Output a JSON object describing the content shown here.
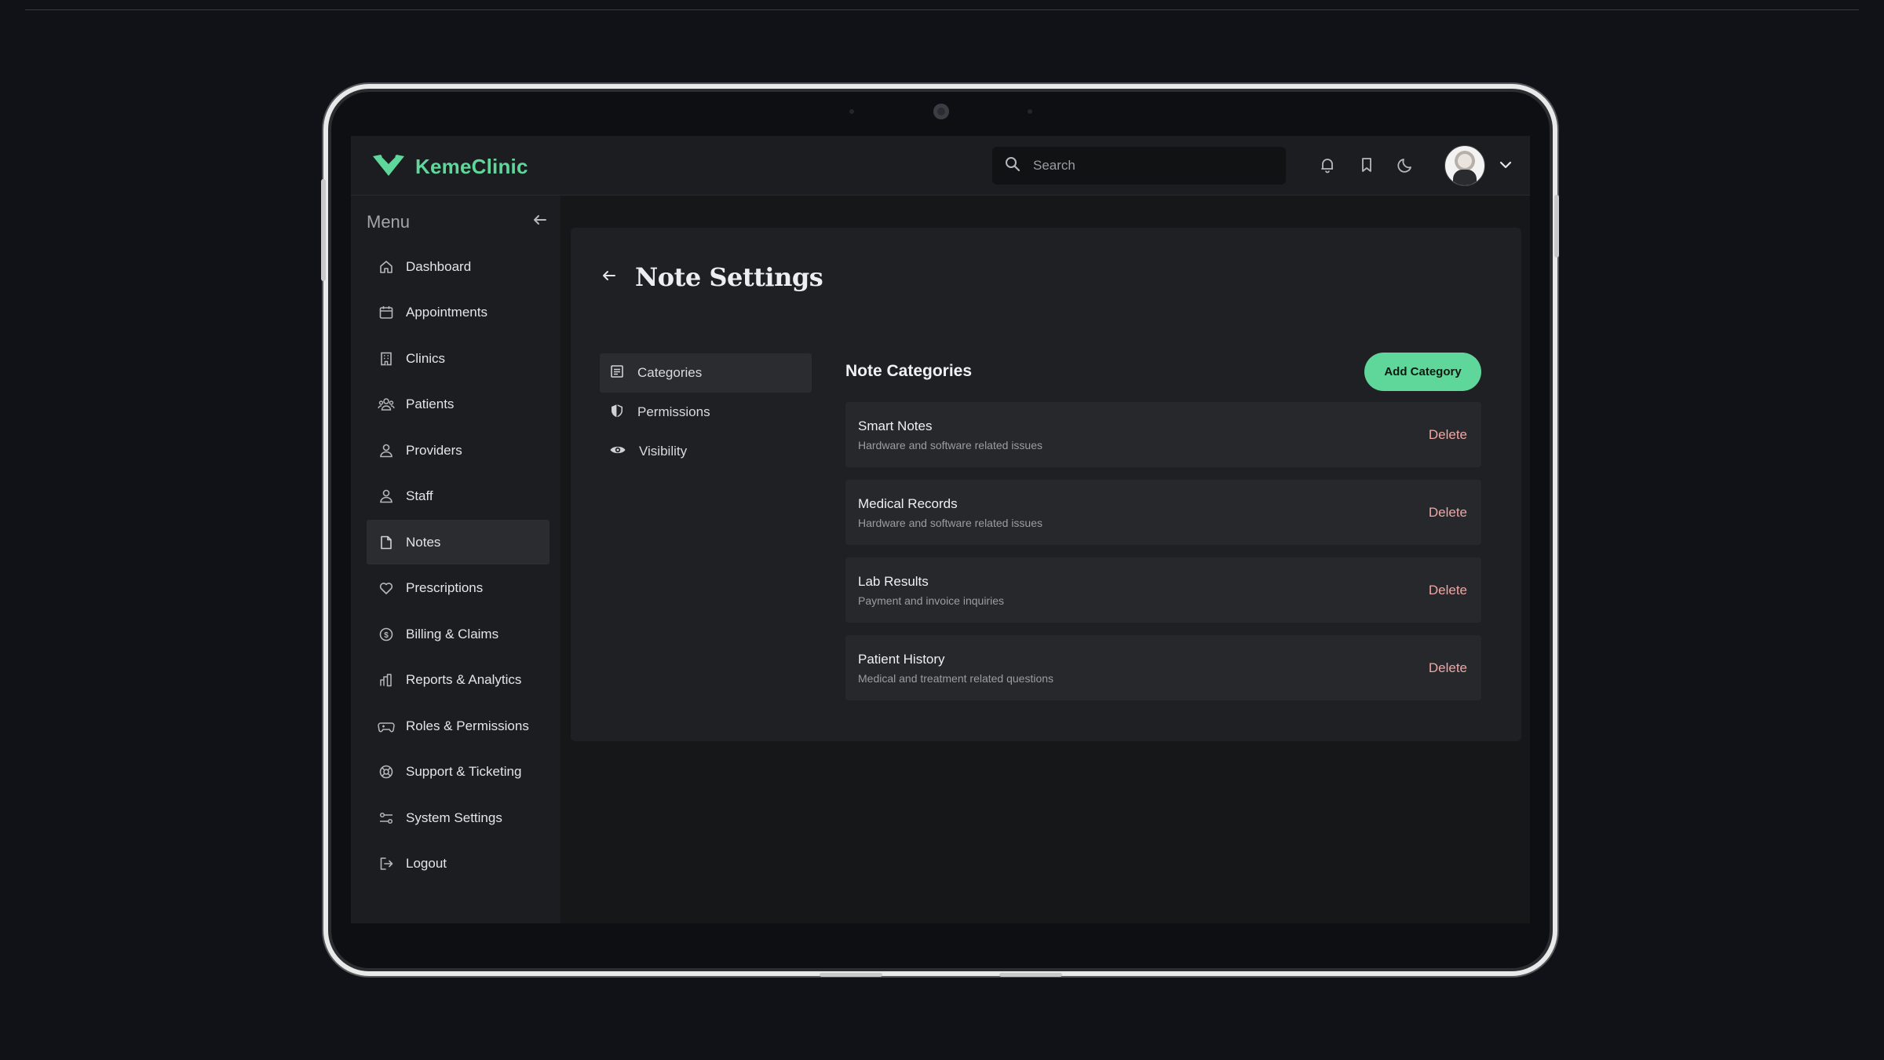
{
  "app": {
    "brand": "KemeClinic"
  },
  "header": {
    "search_placeholder": "Search"
  },
  "sidebar": {
    "title": "Menu",
    "items": [
      {
        "label": "Dashboard"
      },
      {
        "label": "Appointments"
      },
      {
        "label": "Clinics"
      },
      {
        "label": "Patients"
      },
      {
        "label": "Providers"
      },
      {
        "label": "Staff"
      },
      {
        "label": "Notes",
        "active": true
      },
      {
        "label": "Prescriptions"
      },
      {
        "label": "Billing & Claims"
      },
      {
        "label": "Reports & Analytics"
      },
      {
        "label": "Roles & Permissions"
      },
      {
        "label": "Support & Ticketing"
      },
      {
        "label": "System Settings"
      },
      {
        "label": "Logout"
      }
    ]
  },
  "page": {
    "title": "Note Settings",
    "subnav": [
      {
        "label": "Categories",
        "active": true
      },
      {
        "label": "Permissions"
      },
      {
        "label": "Visibility"
      }
    ],
    "categories_title": "Note Categories",
    "add_label": "Add Category",
    "delete_label": "Delete",
    "categories": [
      {
        "name": "Smart Notes",
        "desc": "Hardware and software related issues"
      },
      {
        "name": "Medical Records",
        "desc": "Hardware and software related issues"
      },
      {
        "name": "Lab Results",
        "desc": "Payment and invoice inquiries"
      },
      {
        "name": "Patient History",
        "desc": "Medical and treatment related questions"
      }
    ]
  },
  "colors": {
    "accent": "#5fd69a",
    "danger_text": "#f0a6a3",
    "background": "#101217"
  }
}
